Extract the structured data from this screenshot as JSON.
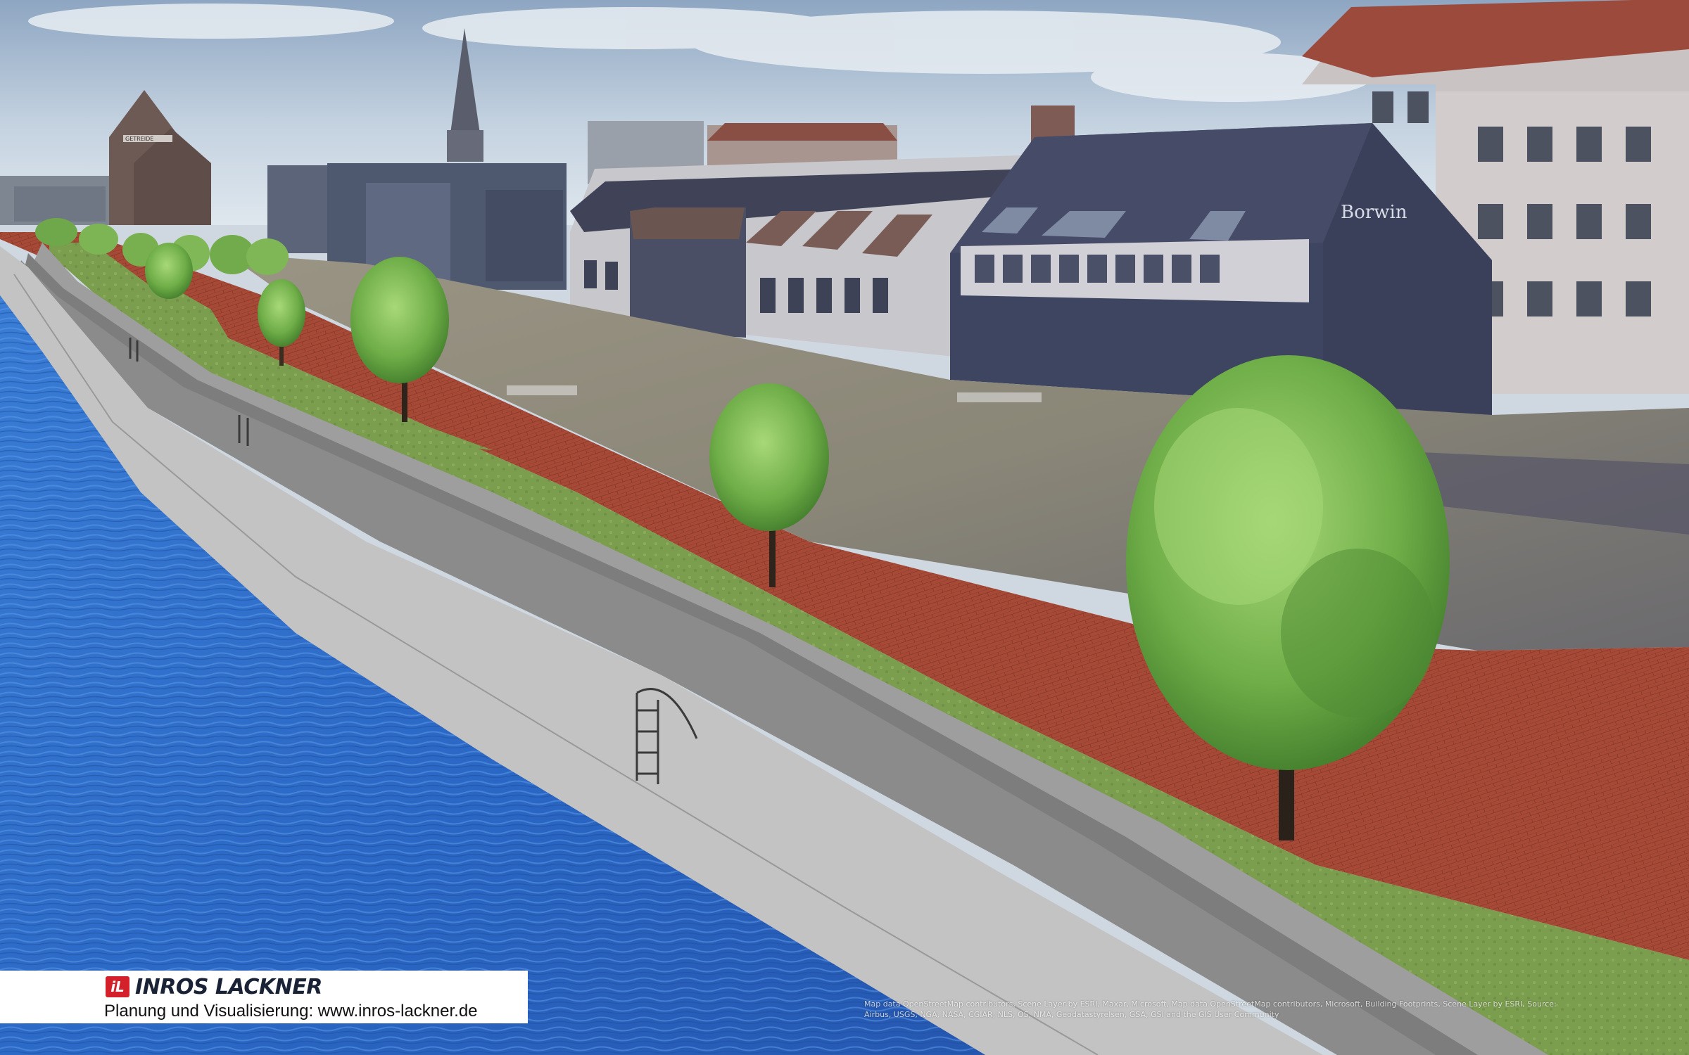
{
  "branding": {
    "logo_mark": "iL",
    "company": "INROS LACKNER",
    "caption": "Planung und Visualisierung: www.inros-lackner.de",
    "brand_color": "#d4202a"
  },
  "scene": {
    "building_sign": "Borwin",
    "warehouse_sign": "GETREIDE",
    "colors": {
      "water": "#2f6fd0",
      "promenade": "#a84b38",
      "lawn": "#7fa052",
      "quay": "#bdbdbd",
      "sky": "#c9d6e2"
    }
  },
  "attribution": {
    "line1": "Map data OpenStreetMap contributors, Scene Layer by ESRI, Maxar, Microsoft, Map data OpenStreetMap contributors, Microsoft, Building Footprints, Scene Layer by ESRI, Source:",
    "line2": "Airbus, USGS, NGA, NASA, CGIAR, NLS, OS, NMA, Geodatastyrelsen, GSA, GSI and the GIS User Community"
  }
}
